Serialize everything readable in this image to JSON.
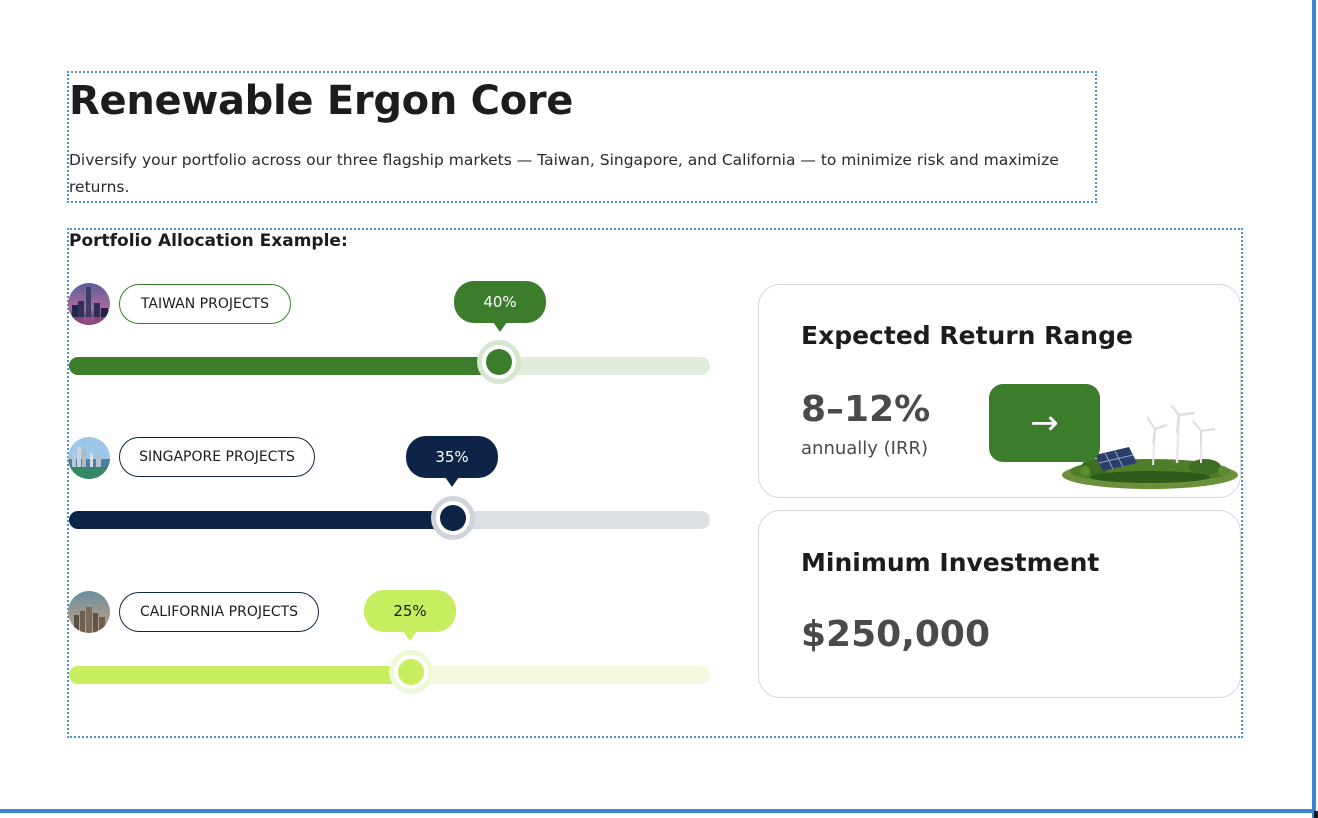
{
  "header": {
    "title": "Renewable Ergon Core",
    "subtitle": "Diversify your portfolio across our three flagship markets — Taiwan, Singapore, and California — to minimize risk and maximize returns."
  },
  "allocation": {
    "label": "Portfolio Allocation Example:",
    "items": [
      {
        "name": "TAIWAN PROJECTS",
        "percent_label": "40%",
        "slider_position": 0.67,
        "color": "#3b7d2b",
        "track_color": "#e1ecdc",
        "pill_border": "#3b7d2b",
        "thumb_ring": "#d6e6cf",
        "bubble_text": "#ffffff",
        "icon": "taipei-skyline-photo"
      },
      {
        "name": "SINGAPORE PROJECTS",
        "percent_label": "35%",
        "slider_position": 0.6,
        "color": "#0e2447",
        "track_color": "#dcdfe4",
        "pill_border": "#0e2447",
        "thumb_ring": "#cfd4dc",
        "bubble_text": "#ffffff",
        "icon": "singapore-skyline-photo"
      },
      {
        "name": "CALIFORNIA PROJECTS",
        "percent_label": "25%",
        "slider_position": 0.53,
        "color": "#c6ee5e",
        "track_color": "#f3fadf",
        "pill_border": "#0e2447",
        "thumb_ring": "#eef8d6",
        "bubble_text": "#1c1c1c",
        "icon": "california-skyline-photo"
      }
    ]
  },
  "cards": {
    "return": {
      "title": "Expected Return Range",
      "value": "8–12%",
      "caption": "annually (IRR)",
      "arrow": "→",
      "icon": "arrow-right-icon",
      "image": "solar-wind-island-illustration"
    },
    "investment": {
      "title": "Minimum Investment",
      "value": "$250,000"
    }
  },
  "colors": {
    "accent_green": "#3b7d2b",
    "navy": "#0e2447",
    "lime": "#c6ee5e",
    "frame_blue": "#3a86d4"
  }
}
